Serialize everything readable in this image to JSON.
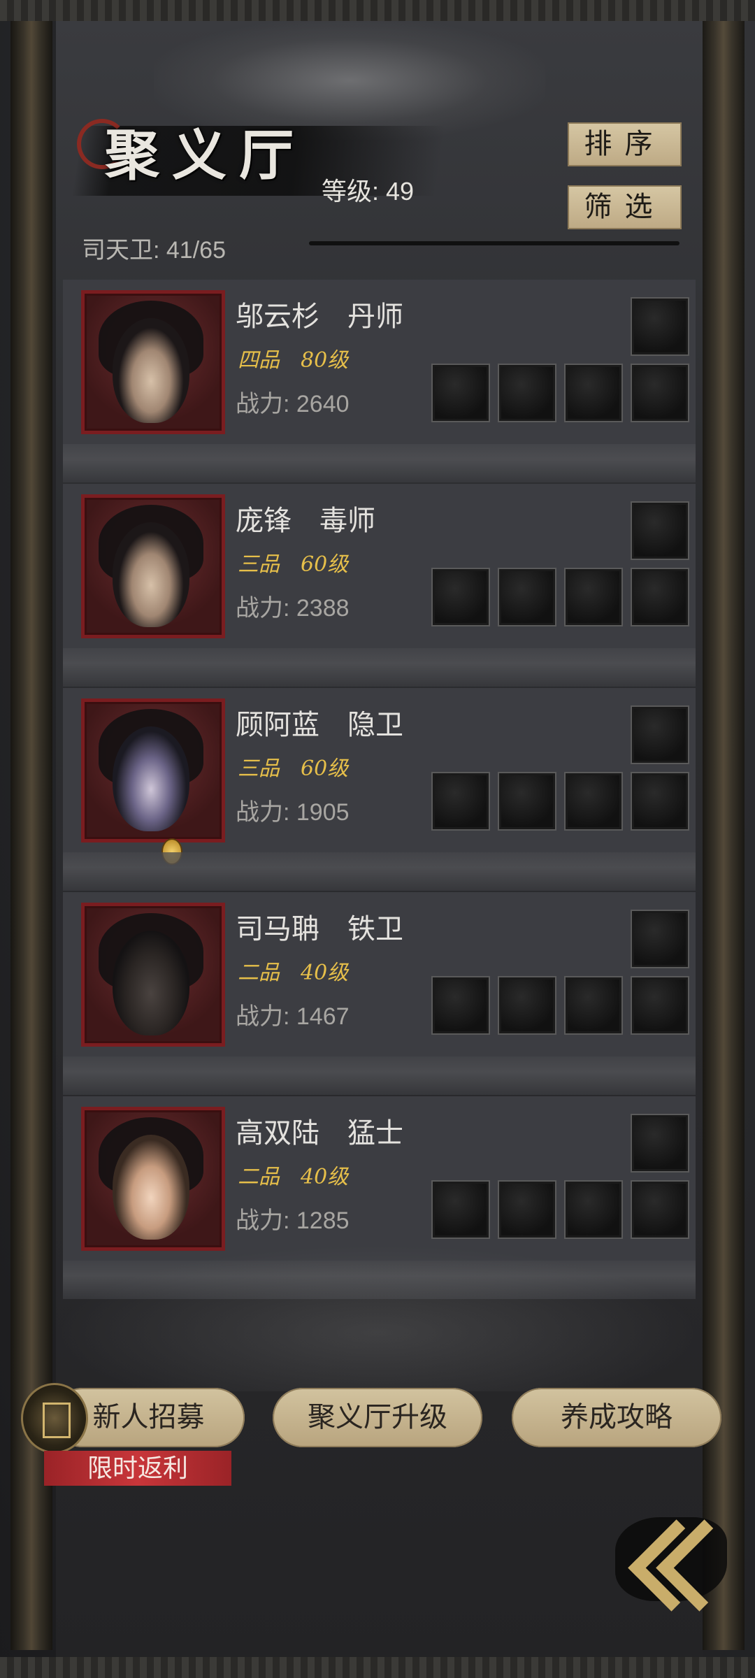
{
  "header": {
    "title": "聚义厅",
    "level_text": "等级: 49",
    "roster_text": "司天卫: 41/65",
    "sort_label": "排序",
    "filter_label": "筛选"
  },
  "characters": [
    {
      "name": "邬云杉　丹师",
      "rank": "四品　80级",
      "power": "战力: 2640"
    },
    {
      "name": "庞锋　毒师",
      "rank": "三品　60级",
      "power": "战力: 2388"
    },
    {
      "name": "顾阿蓝　隐卫",
      "rank": "三品　60级",
      "power": "战力: 1905"
    },
    {
      "name": "司马聃　铁卫",
      "rank": "二品　40级",
      "power": "战力: 1467"
    },
    {
      "name": "高双陆　猛士",
      "rank": "二品　40级",
      "power": "战力: 1285"
    }
  ],
  "bottom": {
    "recruit_label": "新人招募",
    "upgrade_label": "聚义厅升级",
    "guide_label": "养成攻略",
    "promo_label": "限时返利"
  },
  "icons": {
    "back": "double-chevron-left-icon",
    "recruit": "recruit-card-icon"
  },
  "colors": {
    "accent_gold": "#e6bf4a",
    "button_beige": "#c9b892",
    "portrait_frame": "#7a1d20",
    "promo_red": "#c8363a"
  }
}
